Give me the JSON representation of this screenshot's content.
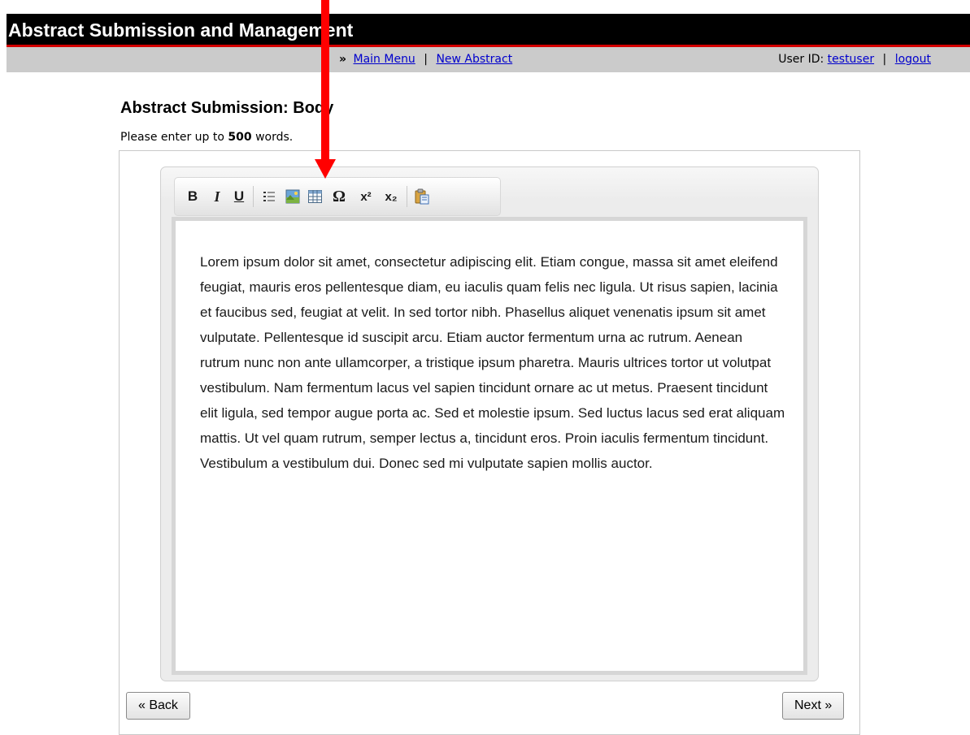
{
  "header": {
    "title": "Abstract Submission and Management"
  },
  "nav": {
    "prefix": "»",
    "main_menu": "Main Menu",
    "separator": "|",
    "new_abstract": "New Abstract",
    "user_label": "User ID:",
    "user_id": "testuser",
    "logout": "logout"
  },
  "page": {
    "title": "Abstract Submission: Body",
    "instructions_before": "Please enter up to",
    "word_limit": "500",
    "instructions_after": "words."
  },
  "editor": {
    "toolbar": [
      {
        "name": "bold-icon",
        "glyph": "B"
      },
      {
        "name": "italic-icon",
        "glyph": "I"
      },
      {
        "name": "underline-icon",
        "glyph": "U"
      },
      {
        "name": "bulleted-list-icon",
        "glyph": ""
      },
      {
        "name": "insert-image-icon",
        "glyph": ""
      },
      {
        "name": "insert-table-icon",
        "glyph": ""
      },
      {
        "name": "special-character-icon",
        "glyph": "Ω"
      },
      {
        "name": "superscript-icon",
        "glyph": "x²"
      },
      {
        "name": "subscript-icon",
        "glyph": "x₂"
      },
      {
        "name": "paste-icon",
        "glyph": ""
      }
    ],
    "content": "Lorem ipsum dolor sit amet, consectetur adipiscing elit. Etiam congue, massa sit amet eleifend feugiat, mauris eros pellentesque diam, eu iaculis quam felis nec ligula. Ut risus sapien, lacinia et faucibus sed, feugiat at velit. In sed tortor nibh. Phasellus aliquet venenatis ipsum sit amet vulputate. Pellentesque id suscipit arcu. Etiam auctor fermentum urna ac rutrum. Aenean rutrum nunc non ante ullamcorper, a tristique ipsum pharetra. Mauris ultrices tortor ut volutpat vestibulum. Nam fermentum lacus vel sapien tincidunt ornare ac ut metus. Praesent tincidunt elit ligula, sed tempor augue porta ac. Sed et molestie ipsum. Sed luctus lacus sed erat aliquam mattis. Ut vel quam rutrum, semper lectus a, tincidunt eros. Proin iaculis fermentum tincidunt. Vestibulum a vestibulum dui. Donec sed mi vulputate sapien mollis auctor."
  },
  "buttons": {
    "back": "« Back",
    "next": "Next »"
  },
  "annotation": {
    "color": "#ff0000",
    "target": "insert-image-icon"
  },
  "colors": {
    "header_bg": "#000000",
    "header_accent": "#d40000",
    "nav_bg": "#cbcbcb",
    "link": "#0000cc"
  }
}
